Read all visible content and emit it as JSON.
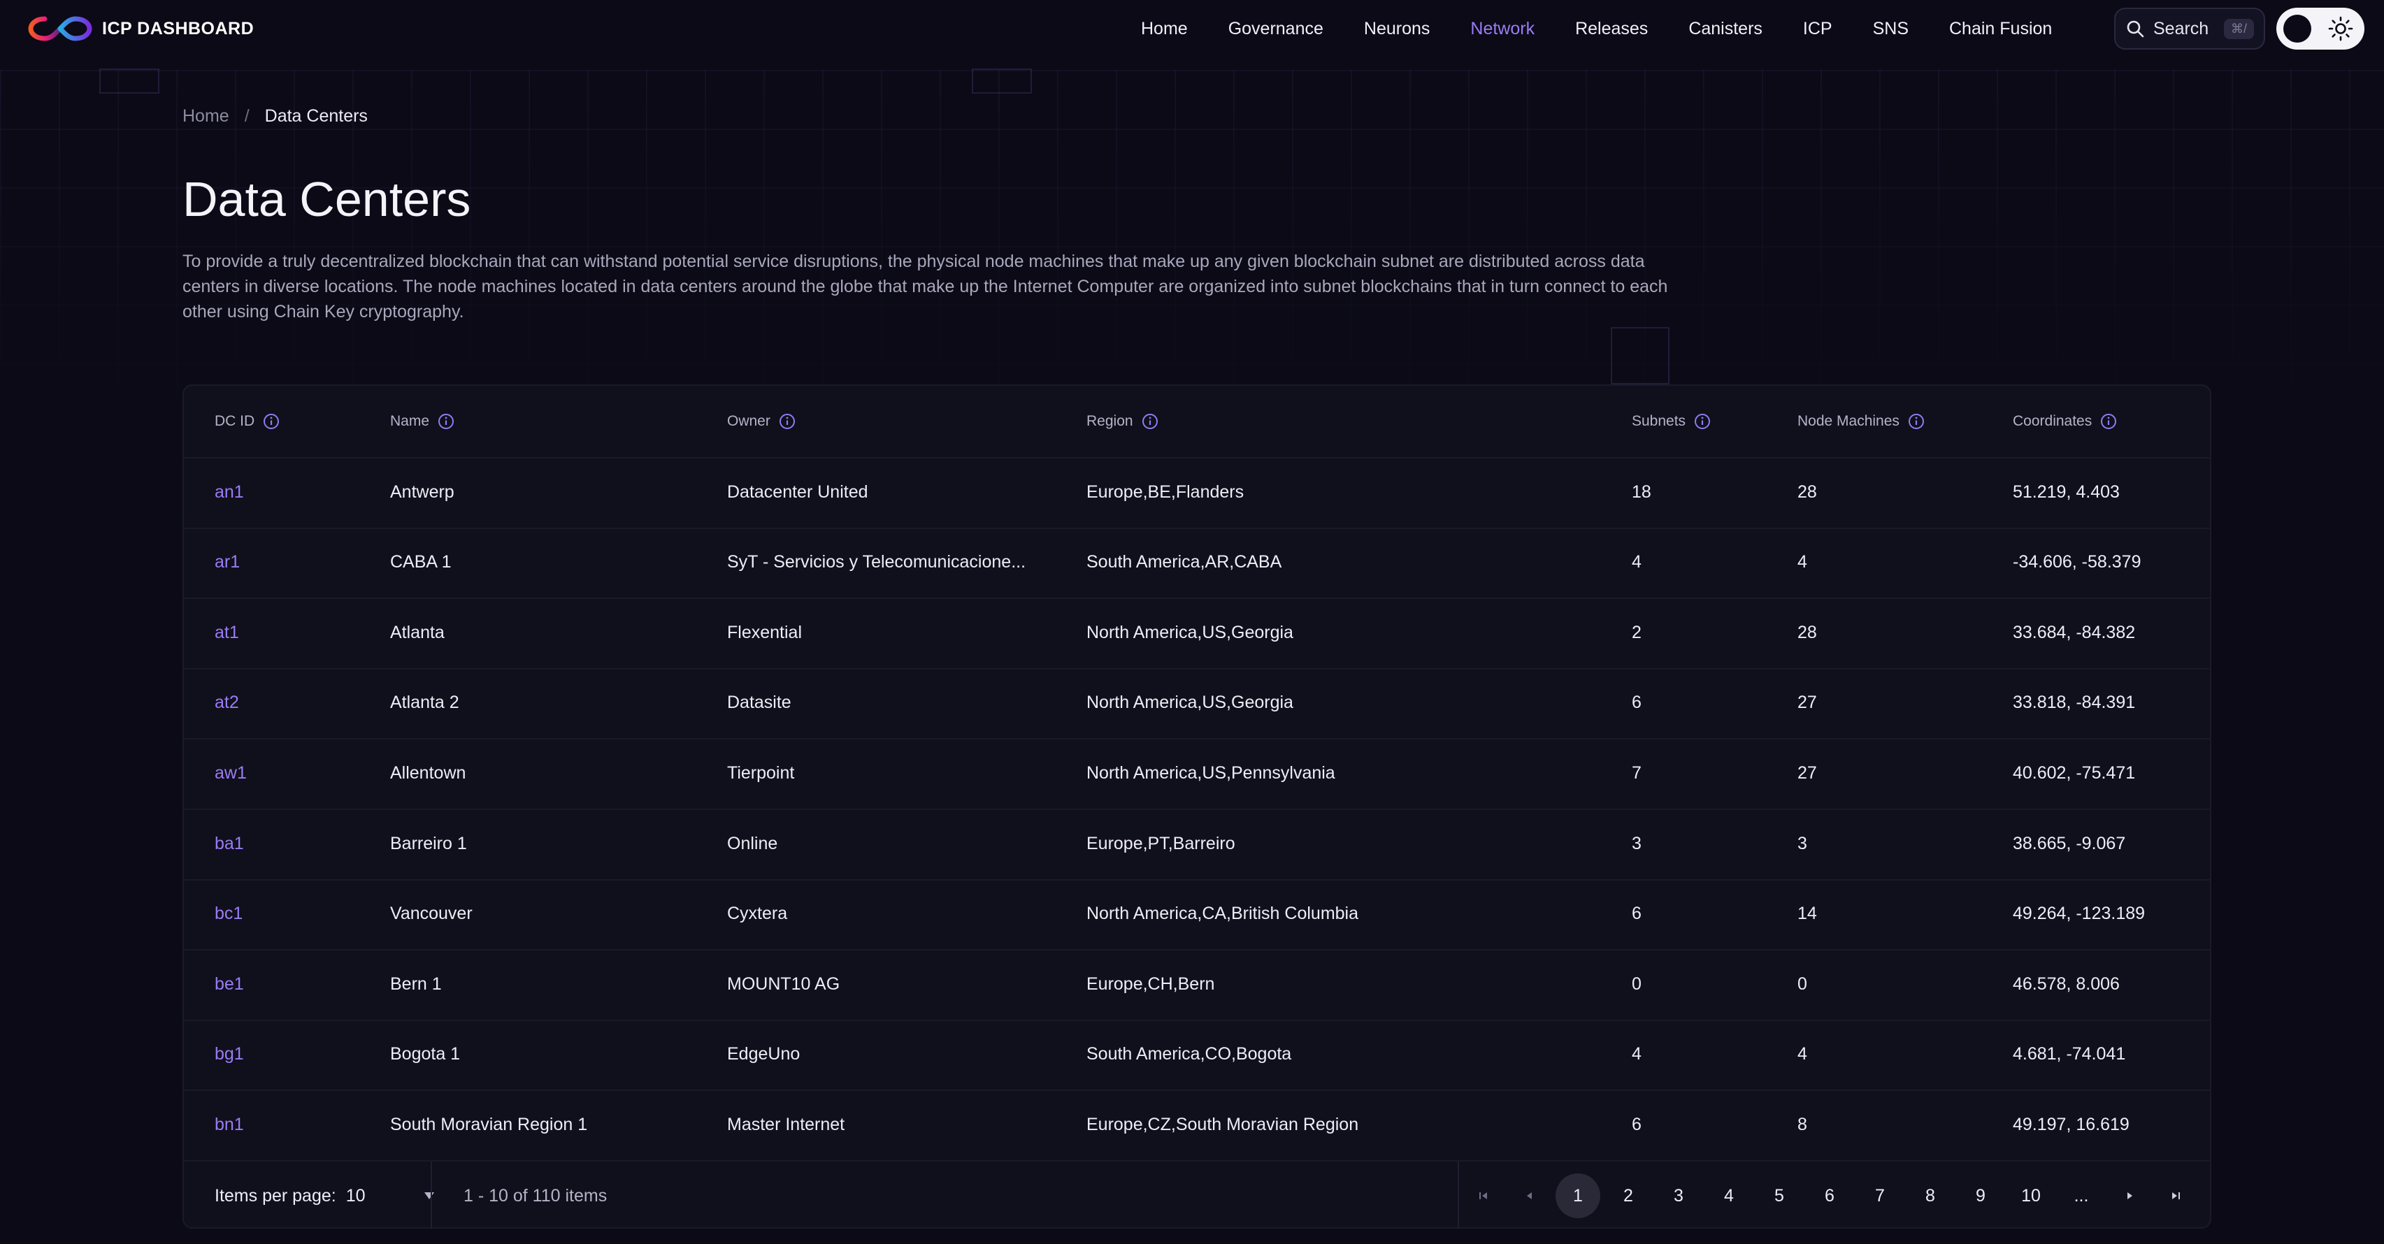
{
  "header": {
    "logo_text": "ICP DASHBOARD",
    "nav": [
      {
        "label": "Home",
        "active": false
      },
      {
        "label": "Governance",
        "active": false
      },
      {
        "label": "Neurons",
        "active": false
      },
      {
        "label": "Network",
        "active": true
      },
      {
        "label": "Releases",
        "active": false
      },
      {
        "label": "Canisters",
        "active": false
      },
      {
        "label": "ICP",
        "active": false
      },
      {
        "label": "SNS",
        "active": false
      },
      {
        "label": "Chain Fusion",
        "active": false
      }
    ],
    "search_label": "Search",
    "search_shortcut": "⌘/",
    "accent_color": "#9a7cf5"
  },
  "breadcrumb": {
    "home": "Home",
    "separator": "/",
    "current": "Data Centers"
  },
  "page": {
    "title": "Data Centers",
    "description": "To provide a truly decentralized blockchain that can withstand potential service disruptions, the physical node machines that make up any given blockchain subnet are distributed across data centers in diverse locations. The node machines located in data centers around the globe that make up the Internet Computer are organized into subnet blockchains that in turn connect to each other using Chain Key cryptography."
  },
  "table": {
    "columns": [
      "DC ID",
      "Name",
      "Owner",
      "Region",
      "Subnets",
      "Node Machines",
      "Coordinates"
    ],
    "rows": [
      {
        "dcid": "an1",
        "name": "Antwerp",
        "owner": "Datacenter United",
        "region": "Europe,BE,Flanders",
        "subnets": "18",
        "nodes": "28",
        "coords": "51.219, 4.403"
      },
      {
        "dcid": "ar1",
        "name": "CABA 1",
        "owner": "SyT - Servicios y Telecomunicacione...",
        "region": "South America,AR,CABA",
        "subnets": "4",
        "nodes": "4",
        "coords": "-34.606, -58.379"
      },
      {
        "dcid": "at1",
        "name": "Atlanta",
        "owner": "Flexential",
        "region": "North America,US,Georgia",
        "subnets": "2",
        "nodes": "28",
        "coords": "33.684, -84.382"
      },
      {
        "dcid": "at2",
        "name": "Atlanta 2",
        "owner": "Datasite",
        "region": "North America,US,Georgia",
        "subnets": "6",
        "nodes": "27",
        "coords": "33.818, -84.391"
      },
      {
        "dcid": "aw1",
        "name": "Allentown",
        "owner": "Tierpoint",
        "region": "North America,US,Pennsylvania",
        "subnets": "7",
        "nodes": "27",
        "coords": "40.602, -75.471"
      },
      {
        "dcid": "ba1",
        "name": "Barreiro 1",
        "owner": "Online",
        "region": "Europe,PT,Barreiro",
        "subnets": "3",
        "nodes": "3",
        "coords": "38.665, -9.067"
      },
      {
        "dcid": "bc1",
        "name": "Vancouver",
        "owner": "Cyxtera",
        "region": "North America,CA,British Columbia",
        "subnets": "6",
        "nodes": "14",
        "coords": "49.264, -123.189"
      },
      {
        "dcid": "be1",
        "name": "Bern 1",
        "owner": "MOUNT10 AG",
        "region": "Europe,CH,Bern",
        "subnets": "0",
        "nodes": "0",
        "coords": "46.578, 8.006"
      },
      {
        "dcid": "bg1",
        "name": "Bogota 1",
        "owner": "EdgeUno",
        "region": "South America,CO,Bogota",
        "subnets": "4",
        "nodes": "4",
        "coords": "4.681, -74.041"
      },
      {
        "dcid": "bn1",
        "name": "South Moravian Region 1",
        "owner": "Master Internet",
        "region": "Europe,CZ,South Moravian Region",
        "subnets": "6",
        "nodes": "8",
        "coords": "49.197, 16.619"
      }
    ]
  },
  "footer": {
    "items_per_page_label": "Items per page:",
    "items_per_page_value": "10",
    "range_text": "1 - 10 of 110 items",
    "pages": [
      "1",
      "2",
      "3",
      "4",
      "5",
      "6",
      "7",
      "8",
      "9",
      "10",
      "..."
    ],
    "current_page": "1"
  }
}
